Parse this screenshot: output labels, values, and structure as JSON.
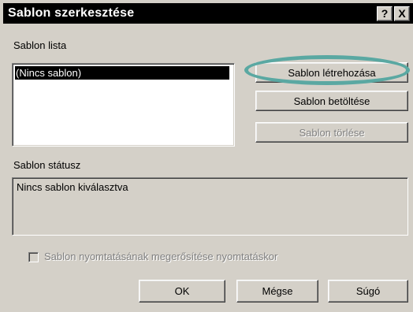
{
  "window": {
    "title": "Sablon szerkesztése",
    "help_button": "?",
    "close_button": "X"
  },
  "template_list": {
    "label": "Sablon lista",
    "items": [
      "(Nincs sablon)"
    ],
    "selected_index": 0
  },
  "buttons": {
    "create": "Sablon létrehozása",
    "load": "Sablon betöltése",
    "delete": "Sablon törlése",
    "ok": "OK",
    "cancel": "Mégse",
    "help": "Súgó"
  },
  "status": {
    "label": "Sablon státusz",
    "text": "Nincs sablon kiválasztva"
  },
  "confirm_checkbox": {
    "label": "Sablon nyomtatásának megerősítése nyomtatáskor",
    "checked": false,
    "enabled": false
  },
  "colors": {
    "dialog_bg": "#d4d0c8",
    "titlebar_bg": "#000000",
    "selection_bg": "#000000",
    "highlight_ring": "#5aa8a2"
  }
}
